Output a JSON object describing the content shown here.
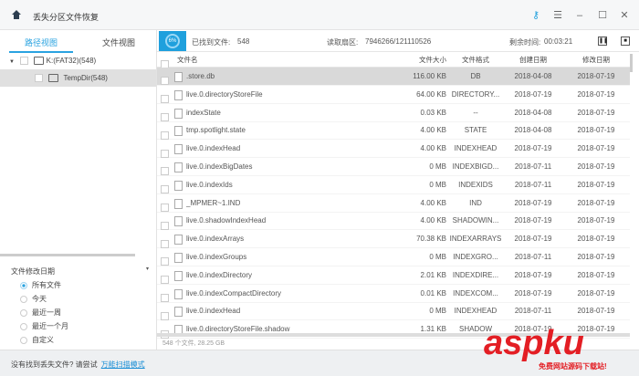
{
  "app": {
    "title": "丢失分区文件恢复"
  },
  "left": {
    "tabs": [
      "路径视图",
      "文件视图"
    ],
    "tree": [
      {
        "label": "K:(FAT32)(548)"
      },
      {
        "label": "TempDir(548)"
      }
    ],
    "filter": {
      "title": "文件修改日期",
      "options": [
        "所有文件",
        "今天",
        "最近一周",
        "最近一个月",
        "自定义"
      ],
      "selected": 0
    }
  },
  "scan": {
    "percent": "6%",
    "found_label": "已找到文件:",
    "found": "548",
    "sector_label": "读取扇区:",
    "sector": "7946266/121110526",
    "remain_label": "剩余时间:",
    "remain": "00:03:21"
  },
  "table": {
    "headers": [
      "文件名",
      "文件大小",
      "文件格式",
      "创建日期",
      "修改日期"
    ],
    "rows": [
      [
        ".store.db",
        "116.00 KB",
        "DB",
        "2018-04-08",
        "2018-07-19"
      ],
      [
        "live.0.directoryStoreFile",
        "64.00 KB",
        "DIRECTORY...",
        "2018-07-19",
        "2018-07-19"
      ],
      [
        "indexState",
        "0.03 KB",
        "--",
        "2018-04-08",
        "2018-07-19"
      ],
      [
        "tmp.spotlight.state",
        "4.00 KB",
        "STATE",
        "2018-04-08",
        "2018-07-19"
      ],
      [
        "live.0.indexHead",
        "4.00 KB",
        "INDEXHEAD",
        "2018-07-19",
        "2018-07-19"
      ],
      [
        "live.0.indexBigDates",
        "0 MB",
        "INDEXBIGD...",
        "2018-07-11",
        "2018-07-19"
      ],
      [
        "live.0.indexIds",
        "0 MB",
        "INDEXIDS",
        "2018-07-11",
        "2018-07-19"
      ],
      [
        "_MPMER~1.IND",
        "4.00 KB",
        "IND",
        "2018-07-19",
        "2018-07-19"
      ],
      [
        "live.0.shadowIndexHead",
        "4.00 KB",
        "SHADOWIN...",
        "2018-07-19",
        "2018-07-19"
      ],
      [
        "live.0.indexArrays",
        "70.38 KB",
        "INDEXARRAYS",
        "2018-07-19",
        "2018-07-19"
      ],
      [
        "live.0.indexGroups",
        "0 MB",
        "INDEXGRO...",
        "2018-07-11",
        "2018-07-19"
      ],
      [
        "live.0.indexDirectory",
        "2.01 KB",
        "INDEXDIRE...",
        "2018-07-19",
        "2018-07-19"
      ],
      [
        "live.0.indexCompactDirectory",
        "0.01 KB",
        "INDEXCOM...",
        "2018-07-19",
        "2018-07-19"
      ],
      [
        "live.0.indexHead",
        "0 MB",
        "INDEXHEAD",
        "2018-07-11",
        "2018-07-19"
      ],
      [
        "live.0.directoryStoreFile.shadow",
        "1.31 KB",
        "SHADOW",
        "2018-07-19",
        "2018-07-19"
      ]
    ],
    "summary": "548 个文件, 28.25 GB"
  },
  "footer": {
    "text": "没有找到丢失文件? 请尝试",
    "link": "万能扫描模式"
  },
  "watermark": {
    "text": "aspku",
    "sub": "免费网站源码下载站!"
  }
}
